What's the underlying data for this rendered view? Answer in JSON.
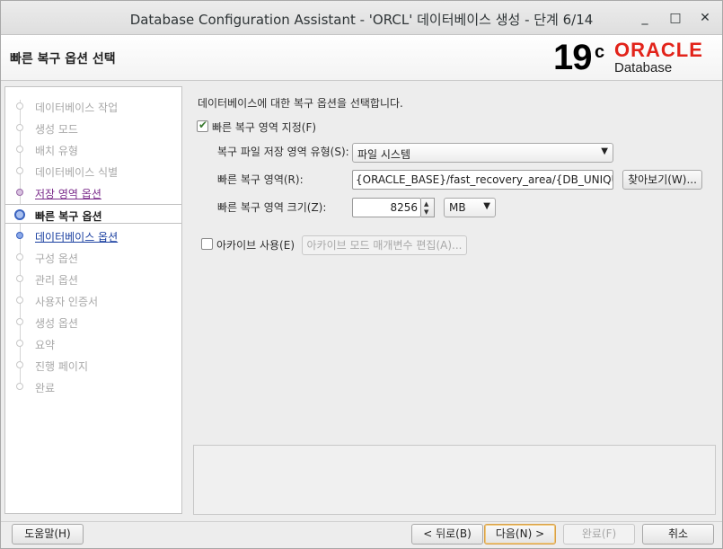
{
  "window": {
    "title": "Database Configuration Assistant - 'ORCL' 데이터베이스 생성 - 단계 6/14",
    "minimize_glyph": "_",
    "maximize_glyph": "□",
    "close_glyph": "✕"
  },
  "header": {
    "page_title": "빠른 복구 옵션 선택",
    "logo_version": "19",
    "logo_suffix": "c",
    "logo_brand": "ORACLE",
    "logo_product": "Database",
    "brand_color": "#e2231a"
  },
  "nav": {
    "items": [
      {
        "label": "데이터베이스 작업",
        "state": "done"
      },
      {
        "label": "생성 모드",
        "state": "done"
      },
      {
        "label": "배치 유형",
        "state": "done"
      },
      {
        "label": "데이터베이스 식별",
        "state": "done"
      },
      {
        "label": "저장 영역 옵션",
        "state": "visited"
      },
      {
        "label": "빠른 복구 옵션",
        "state": "active"
      },
      {
        "label": "데이터베이스 옵션",
        "state": "next"
      },
      {
        "label": "구성 옵션",
        "state": "pending"
      },
      {
        "label": "관리 옵션",
        "state": "pending"
      },
      {
        "label": "사용자 인증서",
        "state": "pending"
      },
      {
        "label": "생성 옵션",
        "state": "pending"
      },
      {
        "label": "요약",
        "state": "pending"
      },
      {
        "label": "진행 페이지",
        "state": "pending"
      },
      {
        "label": "완료",
        "state": "pending"
      }
    ]
  },
  "content": {
    "description": "데이터베이스에 대한 복구 옵션을 선택합니다.",
    "fra_checkbox_label": "빠른 복구 영역 지정(F)",
    "fra_checked": true,
    "storage_type_label": "복구 파일 저장 영역 유형(S):",
    "storage_type_value": "파일 시스템",
    "fra_location_label": "빠른 복구 영역(R):",
    "fra_location_value": "{ORACLE_BASE}/fast_recovery_area/{DB_UNIQUE_NAME}",
    "browse_button": "찾아보기(W)...",
    "fra_size_label": "빠른 복구 영역 크기(Z):",
    "fra_size_value": "8256",
    "fra_size_unit": "MB",
    "archive_checkbox_label": "아카이브 사용(E)",
    "archive_checked": false,
    "archive_params_button": "아카이브 모드 매개변수 편집(A)..."
  },
  "footer": {
    "help_button": "도움말(H)",
    "back_button": "< 뒤로(B)",
    "next_button": "다음(N) >",
    "finish_button": "완료(F)",
    "cancel_button": "취소"
  }
}
